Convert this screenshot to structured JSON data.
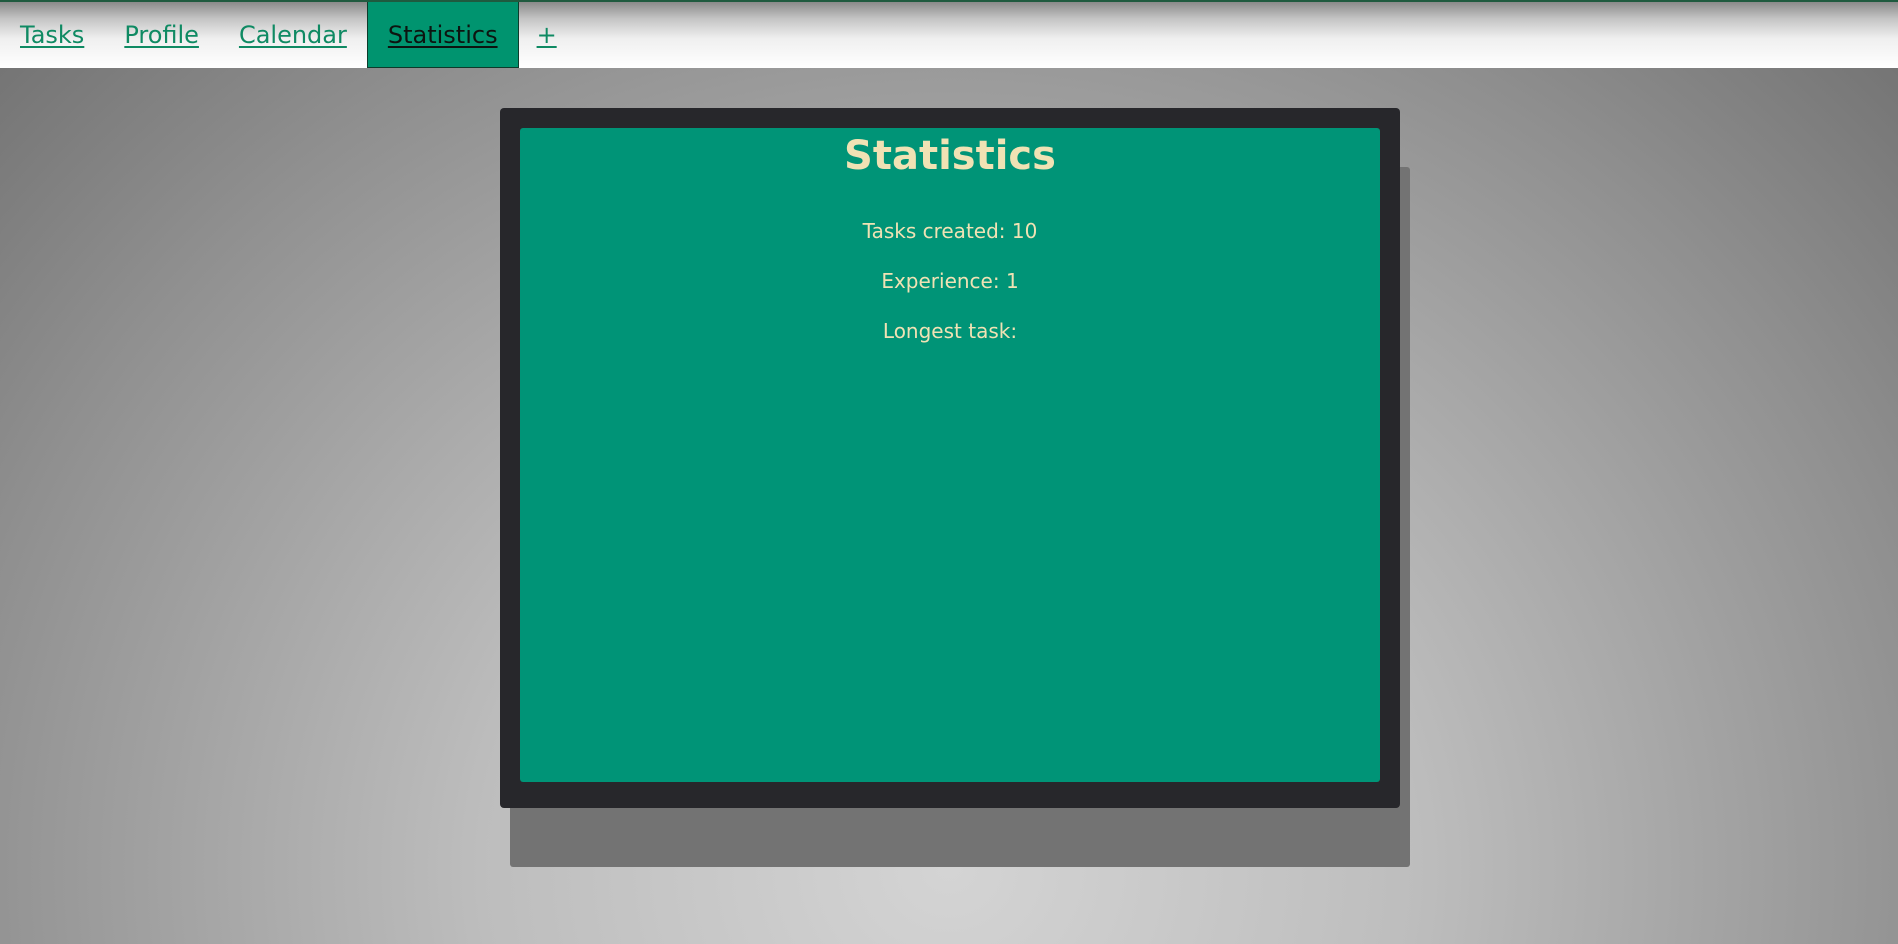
{
  "nav": {
    "tabs": [
      {
        "label": "Tasks"
      },
      {
        "label": "Profile"
      },
      {
        "label": "Calendar"
      },
      {
        "label": "Statistics"
      },
      {
        "label": "+"
      }
    ],
    "active_tab": "Statistics"
  },
  "panel": {
    "title": "Statistics",
    "stats": [
      {
        "text": "Tasks created: 10"
      },
      {
        "text": "Experience: 1"
      },
      {
        "text": "Longest task:"
      }
    ]
  },
  "colors": {
    "accent": "#009477",
    "frame": "#27272b",
    "text_light": "#f0e2b4",
    "link": "#0f8a63"
  }
}
